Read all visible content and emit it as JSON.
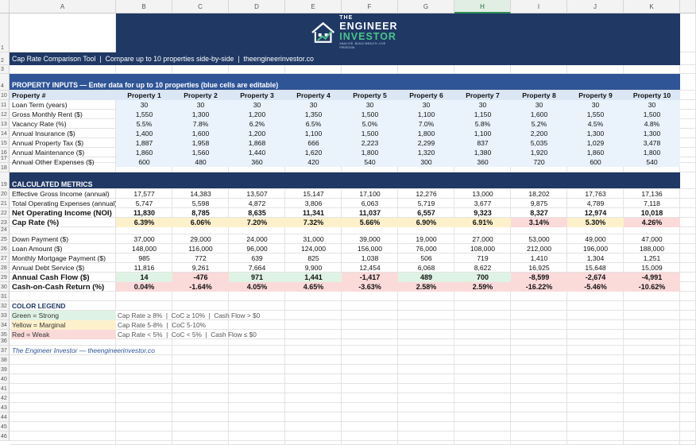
{
  "columns": [
    "A",
    "B",
    "C",
    "D",
    "E",
    "F",
    "G",
    "H",
    "I",
    "J",
    "K"
  ],
  "selected_column": "H",
  "logo": {
    "line1": "THE",
    "line2": "ENGINEER",
    "line3": "INVESTOR",
    "tagline": "ANALYZE. BUILD WEALTH. LIVE FREEDOM."
  },
  "title_bar": "Cap Rate Comparison Tool  |  Compare up to 10 properties side-by-side  |  theengineerinvestor.co",
  "inputs_header": "PROPERTY INPUTS — Enter data for up to 10 properties (blue cells are editable)",
  "property_label": "Property #",
  "properties": [
    "Property 1",
    "Property 2",
    "Property 3",
    "Property 4",
    "Property 5",
    "Property 6",
    "Property 7",
    "Property 8",
    "Property 9",
    "Property 10"
  ],
  "input_rows": [
    {
      "row": "11",
      "label": "Loan Term (years)",
      "values": [
        "30",
        "30",
        "30",
        "30",
        "30",
        "30",
        "30",
        "30",
        "30",
        "30"
      ]
    },
    {
      "row": "12",
      "label": "Gross Monthly Rent ($)",
      "values": [
        "1,550",
        "1,300",
        "1,200",
        "1,350",
        "1,500",
        "1,100",
        "1,150",
        "1,600",
        "1,550",
        "1,500"
      ]
    },
    {
      "row": "13",
      "label": "Vacancy Rate (%)",
      "values": [
        "5.5%",
        "7.8%",
        "6.2%",
        "6.5%",
        "5.0%",
        "7.0%",
        "5.8%",
        "5.2%",
        "4.5%",
        "4.8%"
      ]
    },
    {
      "row": "14",
      "label": "Annual Insurance ($)",
      "values": [
        "1,400",
        "1,600",
        "1,200",
        "1,100",
        "1,500",
        "1,800",
        "1,100",
        "2,200",
        "1,300",
        "1,300"
      ]
    },
    {
      "row": "15",
      "label": "Annual Property Tax ($)",
      "values": [
        "1,887",
        "1,958",
        "1,868",
        "666",
        "2,223",
        "2,299",
        "837",
        "5,035",
        "1,029",
        "3,478"
      ]
    },
    {
      "row": "16",
      "label": "Annual Maintenance ($)",
      "values": [
        "1,860",
        "1,560",
        "1,440",
        "1,620",
        "1,800",
        "1,320",
        "1,380",
        "1,920",
        "1,860",
        "1,800"
      ]
    },
    {
      "row": "17",
      "label": "Annual Other Expenses ($)",
      "values": [
        "600",
        "480",
        "360",
        "420",
        "540",
        "300",
        "360",
        "720",
        "600",
        "540"
      ]
    }
  ],
  "metrics_header": "CALCULATED METRICS",
  "metric_rows_a": [
    {
      "row": "20",
      "label": "Effective Gross Income (annual)",
      "values": [
        "17,577",
        "14,383",
        "13,507",
        "15,147",
        "17,100",
        "12,276",
        "13,000",
        "18,202",
        "17,763",
        "17,136"
      ]
    },
    {
      "row": "21",
      "label": "Total Operating Expenses (annual)",
      "values": [
        "5,747",
        "5,598",
        "4,872",
        "3,806",
        "6,063",
        "5,719",
        "3,677",
        "9,875",
        "4,789",
        "7,118"
      ]
    },
    {
      "row": "22",
      "label": "Net Operating Income (NOI)",
      "bold": true,
      "values": [
        "11,830",
        "8,785",
        "8,635",
        "11,341",
        "11,037",
        "6,557",
        "9,323",
        "8,327",
        "12,974",
        "10,018"
      ]
    },
    {
      "row": "23",
      "label": "Cap Rate (%)",
      "bold": true,
      "values": [
        "6.39%",
        "6.06%",
        "7.20%",
        "7.32%",
        "5.66%",
        "6.90%",
        "6.91%",
        "3.14%",
        "5.30%",
        "4.26%"
      ],
      "status": [
        "yellow",
        "yellow",
        "yellow",
        "yellow",
        "yellow",
        "yellow",
        "yellow",
        "red",
        "yellow",
        "red"
      ]
    }
  ],
  "metric_rows_b": [
    {
      "row": "25",
      "label": "Down Payment ($)",
      "values": [
        "37,000",
        "29,000",
        "24,000",
        "31,000",
        "39,000",
        "19,000",
        "27,000",
        "53,000",
        "49,000",
        "47,000"
      ]
    },
    {
      "row": "26",
      "label": "Loan Amount ($)",
      "values": [
        "148,000",
        "116,000",
        "96,000",
        "124,000",
        "156,000",
        "76,000",
        "108,000",
        "212,000",
        "196,000",
        "188,000"
      ]
    },
    {
      "row": "27",
      "label": "Monthly Mortgage Payment ($)",
      "values": [
        "985",
        "772",
        "639",
        "825",
        "1,038",
        "506",
        "719",
        "1,410",
        "1,304",
        "1,251"
      ]
    },
    {
      "row": "28",
      "label": "Annual Debt Service ($)",
      "values": [
        "11,816",
        "9,261",
        "7,664",
        "9,900",
        "12,454",
        "6,068",
        "8,622",
        "16,925",
        "15,648",
        "15,009"
      ]
    },
    {
      "row": "29",
      "label": "Annual Cash Flow ($)",
      "bold": true,
      "values": [
        "14",
        "-476",
        "971",
        "1,441",
        "-1,417",
        "489",
        "700",
        "-8,599",
        "-2,674",
        "-4,991"
      ],
      "status": [
        "green",
        "red",
        "green",
        "green",
        "red",
        "green",
        "green",
        "red",
        "red",
        "red"
      ]
    },
    {
      "row": "30",
      "label": "Cash-on-Cash Return (%)",
      "bold": true,
      "values": [
        "0.04%",
        "-1.64%",
        "4.05%",
        "4.65%",
        "-3.63%",
        "2.58%",
        "2.59%",
        "-16.22%",
        "-5.46%",
        "-10.62%"
      ],
      "status": [
        "red",
        "red",
        "red",
        "red",
        "red",
        "red",
        "red",
        "red",
        "red",
        "red"
      ]
    }
  ],
  "legend": {
    "title": "COLOR LEGEND",
    "items": [
      {
        "row": "33",
        "label": "Green = Strong",
        "desc": "Cap Rate ≥ 8%  |  CoC ≥ 10%  |  Cash Flow > $0",
        "status": "green"
      },
      {
        "row": "34",
        "label": "Yellow = Marginal",
        "desc": "Cap Rate 5-8%  |  CoC 5-10%",
        "status": "yellow"
      },
      {
        "row": "35",
        "label": "Red = Weak",
        "desc": "Cap Rate < 5%  |  CoC < 5%  |  Cash Flow ≤ $0",
        "status": "red"
      }
    ]
  },
  "footer": "The Engineer Investor — theengineerinvestor.co",
  "row_numbers": [
    "1",
    "2",
    "3",
    "4",
    "10",
    "11",
    "12",
    "13",
    "14",
    "15",
    "16",
    "17",
    "18",
    "19",
    "20",
    "21",
    "22",
    "23",
    "24",
    "25",
    "26",
    "27",
    "28",
    "29",
    "30",
    "31",
    "32",
    "33",
    "34",
    "35",
    "36",
    "37",
    "38",
    "39",
    "40",
    "41",
    "42",
    "43",
    "44",
    "45",
    "46"
  ],
  "colors": {
    "navy": "#1f3864",
    "band": "#2f5597",
    "input": "#eaf3fb",
    "green": "#dff3e4",
    "yellow": "#fdf1cc",
    "red": "#fbdada",
    "accent": "#4cc38a"
  }
}
